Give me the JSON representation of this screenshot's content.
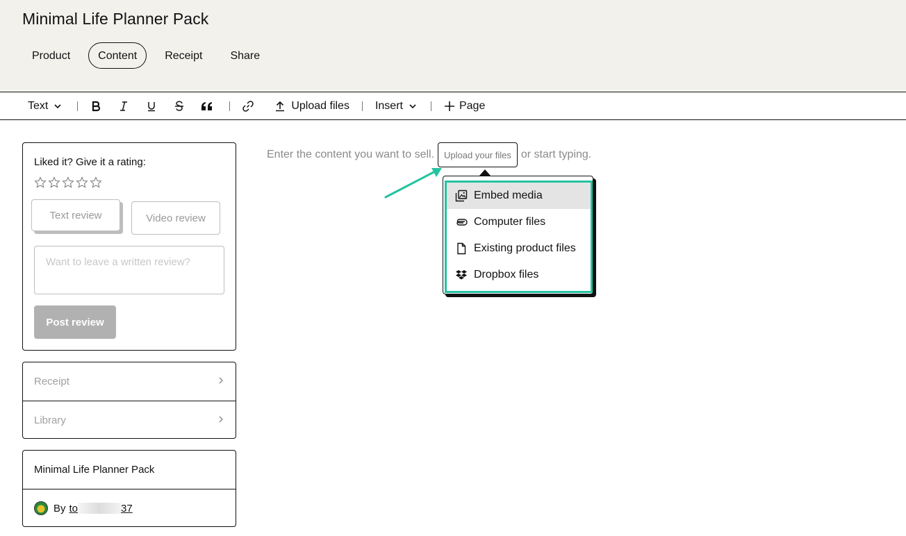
{
  "header": {
    "title": "Minimal Life Planner Pack",
    "tabs": [
      {
        "label": "Product",
        "active": false
      },
      {
        "label": "Content",
        "active": true
      },
      {
        "label": "Receipt",
        "active": false
      },
      {
        "label": "Share",
        "active": false
      }
    ]
  },
  "toolbar": {
    "text_style": "Text",
    "upload_label": "Upload files",
    "insert_label": "Insert",
    "page_label": "Page",
    "icons": [
      "chevron-down-icon",
      "bold-icon",
      "italic-icon",
      "underline-icon",
      "strikethrough-icon",
      "quote-icon",
      "link-icon",
      "upload-icon",
      "plus-icon"
    ]
  },
  "rating_card": {
    "title": "Liked it? Give it a rating:",
    "stars": 5,
    "text_review": "Text review",
    "video_review": "Video review",
    "review_placeholder": "Want to leave a written review?",
    "post_label": "Post review"
  },
  "nav": {
    "items": [
      {
        "label": "Receipt"
      },
      {
        "label": "Library"
      }
    ]
  },
  "product_card": {
    "name": "Minimal Life Planner Pack",
    "by": "By",
    "author_start": "to",
    "author_end": "37"
  },
  "content": {
    "prompt_before": "Enter the content you want to sell.",
    "upload_chip": "Upload your files",
    "prompt_after": "or start typing."
  },
  "upload_menu": {
    "items": [
      {
        "label": "Embed media",
        "icon": "embed-media-icon"
      },
      {
        "label": "Computer files",
        "icon": "paperclip-icon"
      },
      {
        "label": "Existing product files",
        "icon": "file-icon"
      },
      {
        "label": "Dropbox files",
        "icon": "dropbox-icon"
      }
    ]
  },
  "colors": {
    "header_bg": "#f2f1ec",
    "accent": "#22c3a0",
    "menu_hover": "#e4e4e4",
    "button_disabled": "#b1b1b1"
  }
}
